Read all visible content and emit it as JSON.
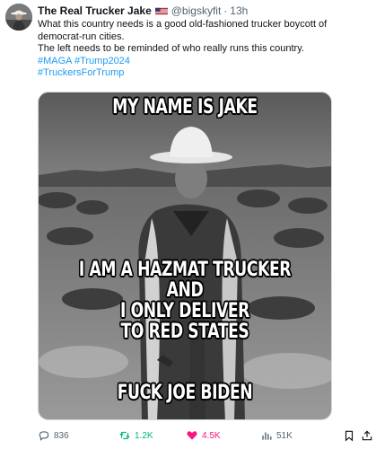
{
  "author": {
    "name": "The Real Trucker Jake",
    "handle": "@bigskyfit",
    "separator": "·",
    "time": "13h"
  },
  "post": {
    "line1": "What this country needs is a good old-fashioned trucker boycott of democrat-run cities.",
    "line2": "The left needs to be reminded of who really runs this country.",
    "hashtags_line1": "#MAGA #Trump2024",
    "hashtags_line2": "#TruckersForTrump"
  },
  "media": {
    "top_text": "MY NAME IS JAKE",
    "mid_text": [
      "I AM A HAZMAT TRUCKER",
      "AND",
      "I ONLY DELIVER",
      "TO RED STATES"
    ],
    "bottom_text": "FUCK JOE BIDEN"
  },
  "actions": {
    "replies": "836",
    "reposts": "1.2K",
    "likes": "4.5K",
    "views": "51K"
  },
  "icons": {
    "reply": "reply-icon",
    "repost": "repost-icon",
    "like": "heart-icon",
    "views": "views-icon",
    "bookmark": "bookmark-icon",
    "share": "share-icon"
  },
  "colors": {
    "link": "#1d9bf0",
    "repost": "#00ba7c",
    "like": "#f91880",
    "muted": "#536471"
  }
}
